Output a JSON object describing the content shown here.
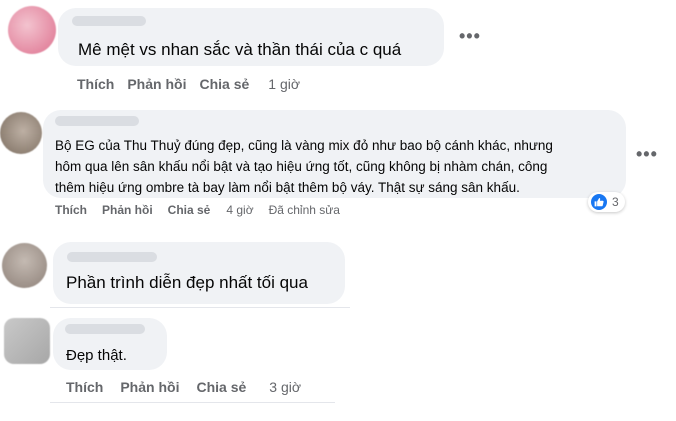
{
  "colors": {
    "bubble": "#f0f2f5",
    "meta_text": "#65676b",
    "like_blue": "#1877f2"
  },
  "comments": [
    {
      "text": "Mê mệt vs nhan sắc và thần thái của c quá",
      "actions": {
        "like": "Thích",
        "reply": "Phản hồi",
        "share": "Chia sẻ",
        "time": "1 giờ"
      },
      "more_icon": "more-horizontal-icon"
    },
    {
      "text": "Bộ EG của Thu Thuỷ đúng đẹp, cũng là vàng mix đỏ như bao bộ cánh khác, nhưng hôm qua lên sân khấu nổi bật và tạo hiệu ứng tốt, cũng không bị nhàm chán, công thêm hiệu ứng ombre tà bay làm nổi bật thêm bộ váy. Thật sự sáng sân khấu.",
      "lines": [
        "Bộ EG của Thu Thuỷ đúng đẹp, cũng là vàng mix đỏ như bao bộ cánh khác, nhưng",
        "hôm qua lên sân khấu nổi bật và tạo hiệu ứng tốt, cũng không bị nhàm chán, công",
        "thêm hiệu ứng ombre tà bay làm nổi bật thêm bộ váy. Thật sự sáng sân khấu."
      ],
      "actions": {
        "like": "Thích",
        "reply": "Phản hồi",
        "share": "Chia sẻ",
        "time": "4 giờ",
        "edited": "Đã chỉnh sửa"
      },
      "reaction_count": "3",
      "more_icon": "more-horizontal-icon"
    },
    {
      "text": "Phần trình diễn đẹp nhất tối qua"
    },
    {
      "text": "Đẹp thật.",
      "actions": {
        "like": "Thích",
        "reply": "Phản hồi",
        "share": "Chia sẻ",
        "time": "3 giờ"
      }
    }
  ]
}
